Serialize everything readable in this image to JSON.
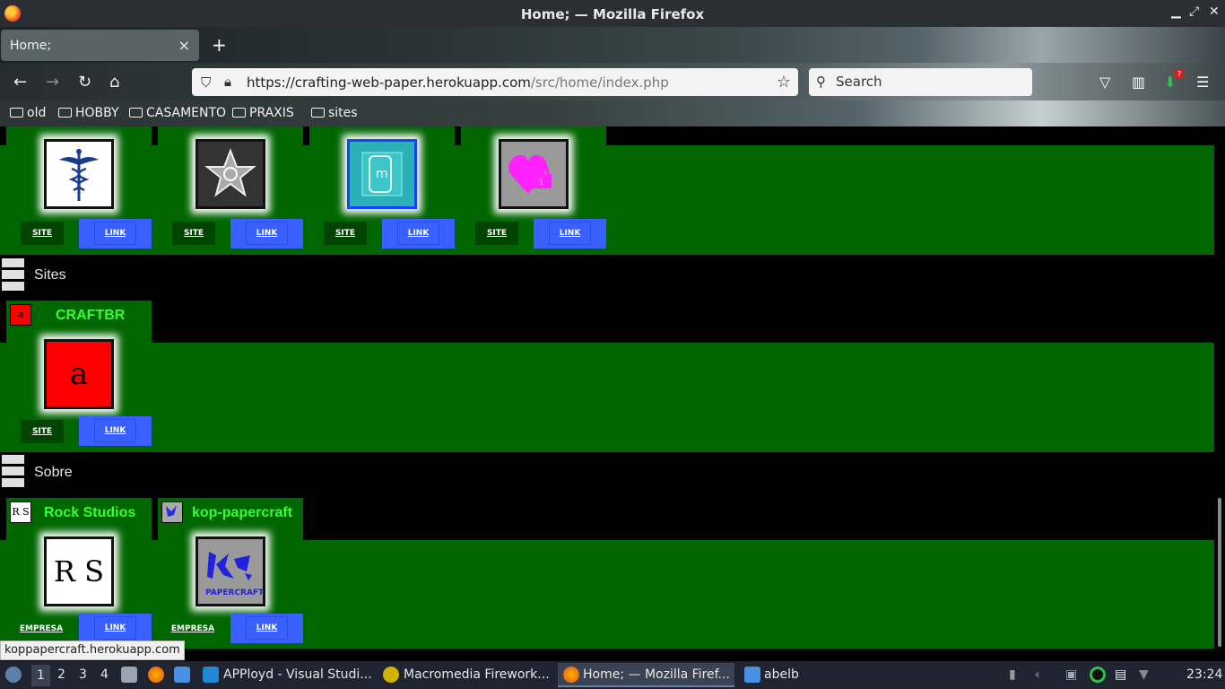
{
  "window": {
    "title": "Home; — Mozilla Firefox",
    "controls": [
      "minimize-icon",
      "maximize-icon",
      "close-icon"
    ]
  },
  "tabs": [
    {
      "label": "Home;",
      "close": "×"
    }
  ],
  "new_tab": "+",
  "navbar": {
    "url_host": "https://crafting-web-paper.herokuapp.com",
    "url_path": "/src/home/index.php",
    "search_placeholder": "Search",
    "badge": "?"
  },
  "bookmarks": [
    "old",
    "HOBBY",
    "CASAMENTO",
    "PRAXIS",
    "sites"
  ],
  "sections": [
    {
      "cards": [
        {
          "icon": "caduceus-icon",
          "site": "SITE",
          "link": "LINK"
        },
        {
          "icon": "star-icon",
          "site": "SITE",
          "link": "LINK"
        },
        {
          "icon": "phone-app-icon",
          "site": "SITE",
          "link": "LINK"
        },
        {
          "icon": "heart-lock-icon",
          "site": "SITE",
          "link": "LINK"
        }
      ]
    },
    {
      "title": "Sites",
      "cards": [
        {
          "title": "CRAFTBR",
          "logo_text": "a",
          "site": "SITE",
          "link": "LINK"
        }
      ]
    },
    {
      "title": "Sobre",
      "cards": [
        {
          "title": "Rock Studios",
          "logo_text": "R S",
          "site": "EMPRESA",
          "link": "LINK"
        },
        {
          "title": "kop-papercraft",
          "logo_text": "PAPERCRAFT",
          "site": "EMPRESA",
          "link": "LINK"
        }
      ]
    }
  ],
  "status_link": "koppapercraft.herokuapp.com",
  "taskbar": {
    "desktops": [
      "1",
      "2",
      "3",
      "4"
    ],
    "apps": [
      {
        "label": "APPloyd - Visual Studi...",
        "icon": "vscode-icon"
      },
      {
        "label": "Macromedia Firework...",
        "icon": "fireworks-icon"
      },
      {
        "label": "Home; — Mozilla Firef...",
        "icon": "firefox-icon"
      },
      {
        "label": "abelb",
        "icon": "folder-icon"
      }
    ],
    "clock": "23:24"
  },
  "colors": {
    "card_green": "#006600",
    "title_green": "#33ff33",
    "link_blue": "#3a5fff"
  }
}
